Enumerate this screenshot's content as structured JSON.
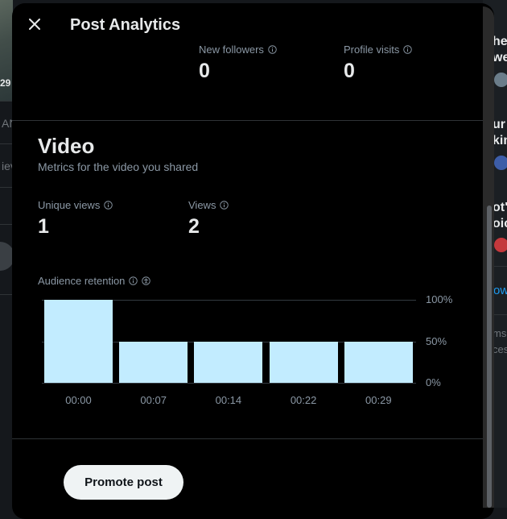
{
  "background": {
    "left_number": "29",
    "left_fragments": [
      "AN",
      "iev"
    ],
    "right_fragments": [
      "hel",
      "we",
      "ur",
      "kin",
      "ot\"",
      "oic"
    ],
    "right_link": "ow",
    "right_gray": [
      "ms",
      "ces"
    ]
  },
  "modal": {
    "title": "Post Analytics",
    "top_metrics": [
      {
        "label": "New followers",
        "value": "0"
      },
      {
        "label": "Profile visits",
        "value": "0"
      }
    ],
    "video": {
      "title": "Video",
      "subtitle": "Metrics for the video you shared",
      "metrics": [
        {
          "label": "Unique views",
          "value": "1"
        },
        {
          "label": "Views",
          "value": "2"
        }
      ],
      "retention_label": "Audience retention"
    },
    "promote_button": "Promote post"
  },
  "colors": {
    "bar": "#c2ecff",
    "modal_bg": "#000000",
    "button_bg": "#eff3f4"
  },
  "icons": [
    "close-icon",
    "info-icon",
    "accessibility-icon"
  ],
  "chart_data": {
    "type": "bar",
    "categories": [
      "00:00",
      "00:07",
      "00:14",
      "00:22",
      "00:29"
    ],
    "values": [
      100,
      50,
      50,
      50,
      50
    ],
    "y_ticks": [
      "100%",
      "50%",
      "0%"
    ],
    "ylim": [
      0,
      100
    ],
    "grid": true
  }
}
